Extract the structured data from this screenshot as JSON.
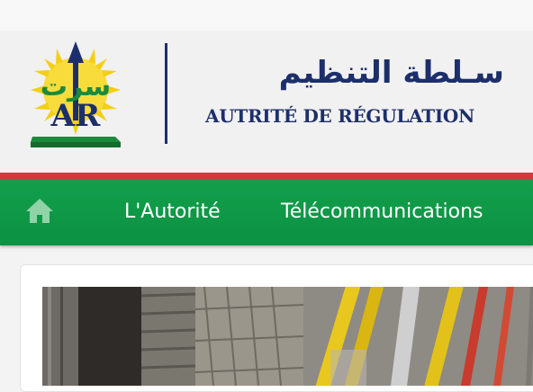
{
  "header": {
    "title_ar": "سـلطة التنظيم",
    "title_fr": "AUTRITÉ DE RÉGULATION",
    "logo": {
      "icon": "art-logo-icon",
      "letters": "AR",
      "script": "سرت"
    }
  },
  "nav": {
    "home_icon": "home-icon",
    "items": [
      {
        "label": "L'Autorité"
      },
      {
        "label": "Télécommunications"
      }
    ]
  },
  "banner": {
    "subject": "cable-trays-photo"
  },
  "colors": {
    "brand_blue": "#1d2f6b",
    "nav_green": "#0f9947",
    "accent_red": "#d8353f",
    "logo_yellow": "#f5d21c",
    "logo_green": "#1b8a3b"
  }
}
